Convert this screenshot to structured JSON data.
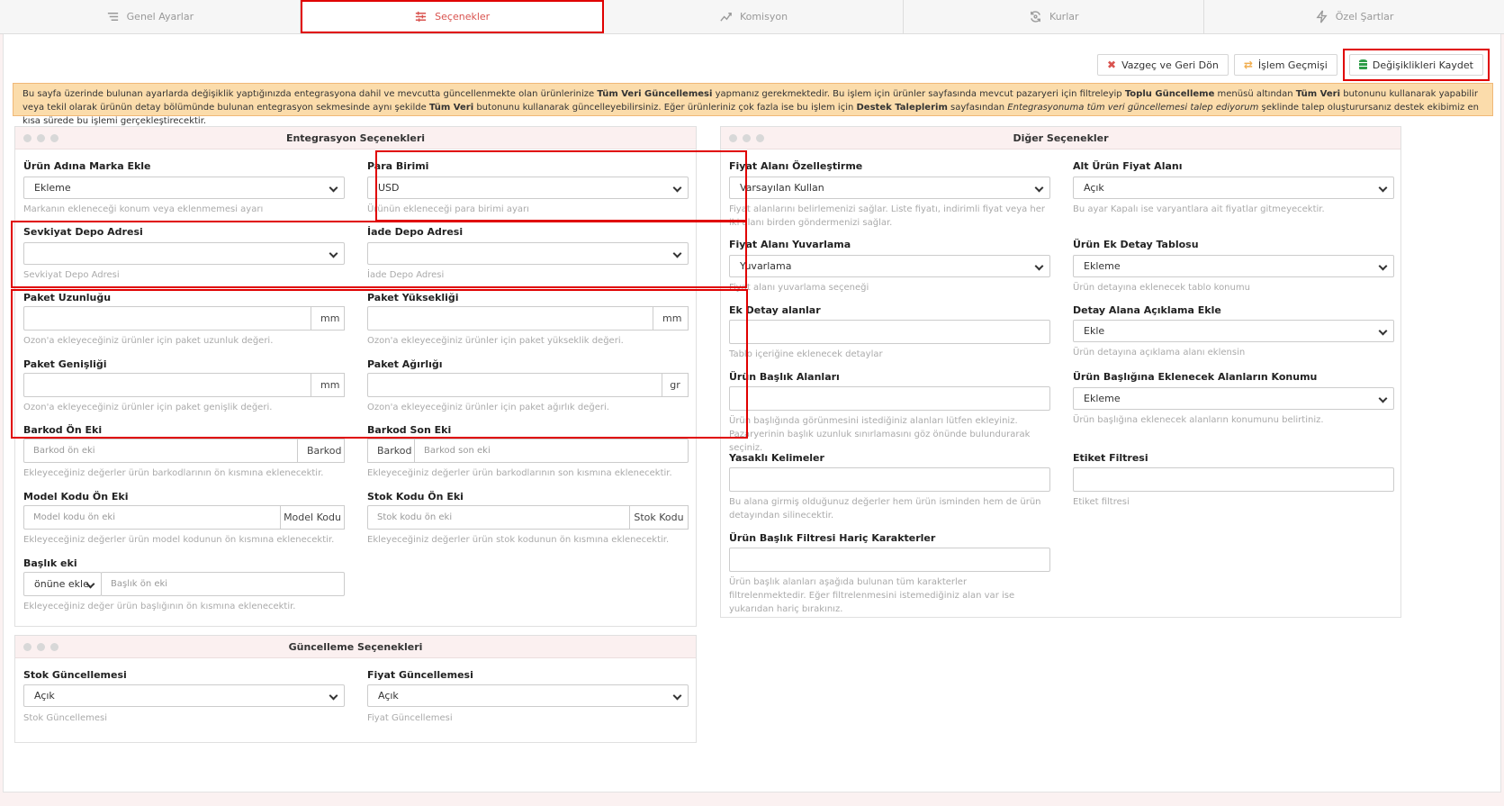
{
  "tabs": [
    {
      "label": "Genel Ayarlar",
      "icon": "list-icon"
    },
    {
      "label": "Seçenekler",
      "icon": "sliders-icon"
    },
    {
      "label": "Komisyon",
      "icon": "chart-icon"
    },
    {
      "label": "Kurlar",
      "icon": "refresh-icon"
    },
    {
      "label": "Özel Şartlar",
      "icon": "bolt-icon"
    }
  ],
  "toolbar": {
    "cancel_label": "Vazgeç ve Geri Dön",
    "history_label": "İşlem Geçmişi",
    "save_label": "Değişiklikleri Kaydet"
  },
  "alert": {
    "t1": "Bu sayfa üzerinde bulunan ayarlarda değişiklik yaptığınızda entegrasyona dahil ve mevcutta güncellenmekte olan ürünlerinize ",
    "b1": "Tüm Veri Güncellemesi",
    "t2": " yapmanız gerekmektedir. Bu işlem için ürünler sayfasında mevcut pazaryeri için filtreleyip ",
    "b2": "Toplu Güncelleme",
    "t3": " menüsü altından ",
    "b3": "Tüm Veri",
    "t4": " butonunu kullanarak yapabilir veya tekil olarak ürünün detay bölümünde bulunan entegrasyon sekmesinde aynı şekilde ",
    "b4": "Tüm Veri",
    "t5": " butonunu kullanarak güncelleyebilirsiniz. Eğer ürünleriniz çok fazla ise bu işlem için ",
    "b5": "Destek Taleplerim",
    "t6": " sayfasından ",
    "i1": "Entegrasyonuma tüm veri güncellemesi talep ediyorum",
    "t7": " şeklinde talep oluşturursanız destek ekibimiz en kısa sürede bu işlemi gerçekleştirecektir."
  },
  "integration": {
    "title": "Entegrasyon Seçenekleri",
    "brand": {
      "label": "Ürün Adına Marka Ekle",
      "value": "Ekleme",
      "hint": "Markanın ekleneceği konum veya eklenmemesi ayarı"
    },
    "currency": {
      "label": "Para Birimi",
      "value": "USD",
      "hint": "Ürünün ekleneceği para birimi ayarı"
    },
    "ship_depot": {
      "label": "Sevkiyat Depo Adresi",
      "value": "",
      "hint": "Sevkiyat Depo Adresi"
    },
    "return_depot": {
      "label": "İade Depo Adresi",
      "value": "",
      "hint": "İade Depo Adresi"
    },
    "pkg_length": {
      "label": "Paket Uzunluğu",
      "unit": "mm",
      "hint": "Ozon'a ekleyeceğiniz ürünler için paket uzunluk değeri."
    },
    "pkg_height": {
      "label": "Paket Yüksekliği",
      "unit": "mm",
      "hint": "Ozon'a ekleyeceğiniz ürünler için paket yükseklik değeri."
    },
    "pkg_width": {
      "label": "Paket Genişliği",
      "unit": "mm",
      "hint": "Ozon'a ekleyeceğiniz ürünler için paket genişlik değeri."
    },
    "pkg_weight": {
      "label": "Paket Ağırlığı",
      "unit": "gr",
      "hint": "Ozon'a ekleyeceğiniz ürünler için paket ağırlık değeri."
    },
    "barcode_prefix": {
      "label": "Barkod Ön Eki",
      "placeholder": "Barkod ön eki",
      "addon": "Barkod",
      "hint": "Ekleyeceğiniz değerler ürün barkodlarının ön kısmına eklenecektir."
    },
    "barcode_suffix": {
      "label": "Barkod Son Eki",
      "placeholder": "Barkod son eki",
      "addon": "Barkod",
      "hint": "Ekleyeceğiniz değerler ürün barkodlarının son kısmına eklenecektir."
    },
    "model_prefix": {
      "label": "Model Kodu Ön Eki",
      "placeholder": "Model kodu ön eki",
      "addon": "Model Kodu",
      "hint": "Ekleyeceğiniz değerler ürün model kodunun ön kısmına eklenecektir."
    },
    "stock_prefix": {
      "label": "Stok Kodu Ön Eki",
      "placeholder": "Stok kodu ön eki",
      "addon": "Stok Kodu",
      "hint": "Ekleyeceğiniz değerler ürün stok kodunun ön kısmına eklenecektir."
    },
    "title_affix": {
      "label": "Başlık eki",
      "mode": "önüne ekle",
      "placeholder": "Başlık ön eki",
      "hint": "Ekleyeceğiniz değer ürün başlığının ön kısmına eklenecektir."
    }
  },
  "other": {
    "title": "Diğer Seçenekler",
    "price_field": {
      "label": "Fiyat Alanı Özelleştirme",
      "value": "Varsayılan Kullan",
      "hint": "Fiyat alanlarını belirlemenizi sağlar. Liste fiyatı, indirimli fiyat veya her iki alanı birden göndermenizi sağlar."
    },
    "sub_price": {
      "label": "Alt Ürün Fiyat Alanı",
      "value": "Açık",
      "hint": "Bu ayar Kapalı ise varyantlara ait fiyatlar gitmeyecektir."
    },
    "price_round": {
      "label": "Fiyat Alanı Yuvarlama",
      "value": "Yuvarlama",
      "hint": "Fiyat alanı yuvarlama seçeneği"
    },
    "extra_table": {
      "label": "Ürün Ek Detay Tablosu",
      "value": "Ekleme",
      "hint": "Ürün detayına eklenecek tablo konumu"
    },
    "extra_fields": {
      "label": "Ek Detay alanlar",
      "hint": "Tablo içeriğine eklenecek detaylar"
    },
    "desc_add": {
      "label": "Detay Alana Açıklama Ekle",
      "value": "Ekle",
      "hint": "Ürün detayına açıklama alanı eklensin"
    },
    "title_fields": {
      "label": "Ürün Başlık Alanları",
      "hint": "Ürün başlığında görünmesini istediğiniz alanları lütfen ekleyiniz. Pazaryerinin başlık uzunluk sınırlamasını göz önünde bulundurarak seçiniz."
    },
    "title_pos": {
      "label": "Ürün Başlığına Eklenecek Alanların Konumu",
      "value": "Ekleme",
      "hint": "Ürün başlığına eklenecek alanların konumunu belirtiniz."
    },
    "banned": {
      "label": "Yasaklı Kelimeler",
      "hint": "Bu alana girmiş olduğunuz değerler hem ürün isminden hem de ürün detayından silinecektir."
    },
    "tag_filter": {
      "label": "Etiket Filtresi",
      "hint": "Etiket filtresi"
    },
    "title_filter": {
      "label": "Ürün Başlık Filtresi Hariç Karakterler",
      "hint": "Ürün başlık alanları aşağıda bulunan tüm karakterler filtrelenmektedir. Eğer filtrelenmesini istemediğiniz alan var ise yukarıdan hariç bırakınız."
    }
  },
  "update": {
    "title": "Güncelleme Seçenekleri",
    "stock": {
      "label": "Stok Güncellemesi",
      "value": "Açık",
      "hint": "Stok Güncellemesi"
    },
    "price": {
      "label": "Fiyat Güncellemesi",
      "value": "Açık",
      "hint": "Fiyat Güncellemesi"
    }
  },
  "colors": {
    "accent": "#d9534f",
    "highlight": "#e00000",
    "alert_bg": "#fbdcab"
  }
}
